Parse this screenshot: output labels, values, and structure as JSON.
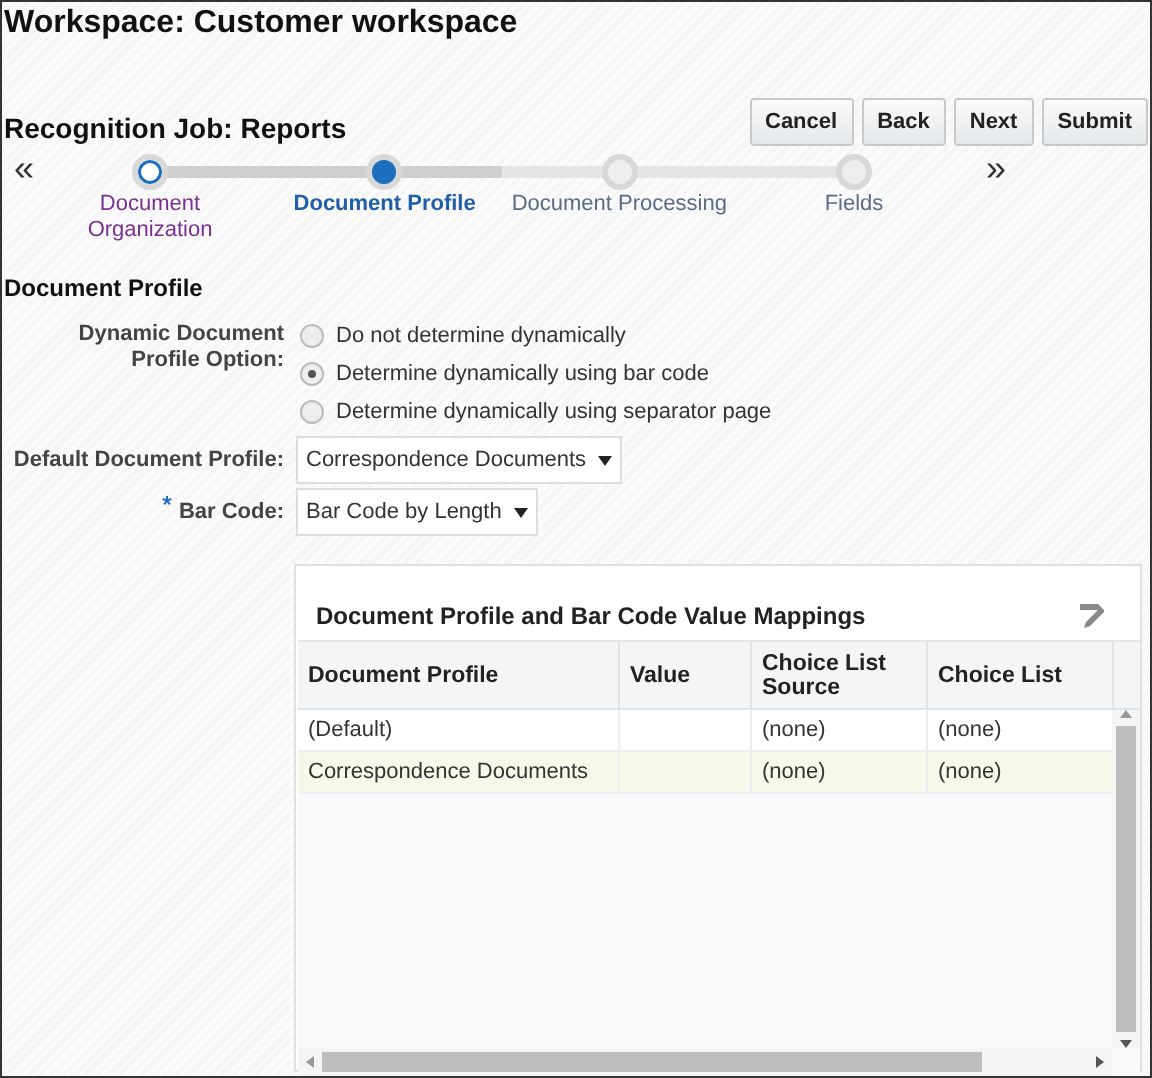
{
  "page_title": "Workspace: Customer workspace",
  "job_title": "Recognition Job: Reports",
  "buttons": [
    "Cancel",
    "Back",
    "Next",
    "Submit"
  ],
  "train": {
    "prev": "«",
    "next": "»",
    "stops": [
      {
        "label": "Document Organization",
        "visited": true,
        "selected": false
      },
      {
        "label": "Document Profile",
        "visited": true,
        "selected": true
      },
      {
        "label": "Document Processing",
        "visited": false,
        "selected": false
      },
      {
        "label": "Fields",
        "visited": false,
        "selected": false
      }
    ]
  },
  "section_title": "Document Profile",
  "dynamic_option": {
    "label": "Dynamic Document Profile Option:",
    "options": [
      {
        "label": "Do not determine dynamically",
        "selected": false
      },
      {
        "label": "Determine dynamically using bar code",
        "selected": true
      },
      {
        "label": "Determine dynamically using separator page",
        "selected": false
      }
    ]
  },
  "default_profile": {
    "label": "Default Document Profile:",
    "value": "Correspondence Documents"
  },
  "bar_code": {
    "label": "Bar Code:",
    "required": true,
    "value": "Bar Code by Length"
  },
  "mappings": {
    "title": "Document Profile and Bar Code Value Mappings",
    "columns": [
      "Document Profile",
      "Value",
      "Choice List Source",
      "Choice List"
    ],
    "rows": [
      {
        "cells": [
          "(Default)",
          "",
          "(none)",
          "(none)"
        ],
        "selected": false
      },
      {
        "cells": [
          "Correspondence Documents",
          "",
          "(none)",
          "(none)"
        ],
        "selected": true
      }
    ]
  }
}
